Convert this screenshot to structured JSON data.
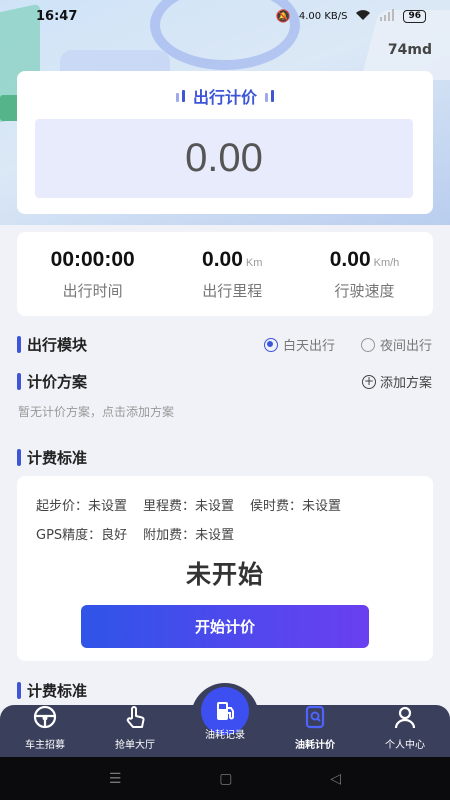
{
  "status_bar": {
    "time": "16:47",
    "net_speed": "4.00 KB/S",
    "battery": "96"
  },
  "header": {
    "user_code": "74md"
  },
  "fare": {
    "title": "出行计价",
    "amount": "0.00"
  },
  "metrics": [
    {
      "value": "00:00:00",
      "unit": "",
      "label": "出行时间"
    },
    {
      "value": "0.00",
      "unit": "Km",
      "label": "出行里程"
    },
    {
      "value": "0.00",
      "unit": "Km/h",
      "label": "行驶速度"
    }
  ],
  "trip_module": {
    "title": "出行模块",
    "options": [
      {
        "label": "白天出行",
        "checked": true
      },
      {
        "label": "夜间出行",
        "checked": false
      }
    ]
  },
  "pricing_plan": {
    "title": "计价方案",
    "add_label": "添加方案",
    "empty_hint": "暂无计价方案，点击添加方案"
  },
  "fee_standard": {
    "title": "计费标准",
    "row1": [
      "起步价：未设置",
      "里程费：未设置",
      "侯时费：未设置"
    ],
    "row2": [
      "GPS精度：良好",
      "附加费：未设置"
    ],
    "state": "未开始",
    "start_button": "开始计价"
  },
  "fee_standard_2": {
    "title": "计费标准"
  },
  "bottom_nav": [
    {
      "label": "车主招募",
      "icon": "steering-wheel-icon"
    },
    {
      "label": "抢单大厅",
      "icon": "hand-tap-icon"
    },
    {
      "label": "油耗记录",
      "icon": "fuel-pump-icon"
    },
    {
      "label": "油耗计价",
      "icon": "fuel-calc-icon",
      "active": true
    },
    {
      "label": "个人中心",
      "icon": "user-icon"
    }
  ],
  "colors": {
    "accent": "#3d56d8",
    "nav_bg": "#3a3f5c",
    "fab": "#3d4ff0"
  }
}
